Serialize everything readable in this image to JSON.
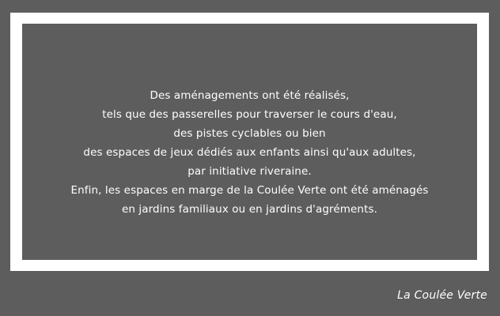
{
  "panel": {
    "lines": [
      "Des aménagements ont été réalisés,",
      "tels que des passerelles pour traverser le cours d'eau,",
      "des pistes cyclables ou bien",
      "des espaces de jeux dédiés aux enfants ainsi qu'aux adultes,",
      "par initiative riveraine.",
      "Enfin, les espaces en marge de la Coulée Verte ont été aménagés",
      "en jardins familiaux ou en jardins d'agréments."
    ]
  },
  "caption": "La Coulée Verte",
  "colors": {
    "background": "#5d5d5d",
    "frame": "#ffffff",
    "text": "#ffffff"
  }
}
